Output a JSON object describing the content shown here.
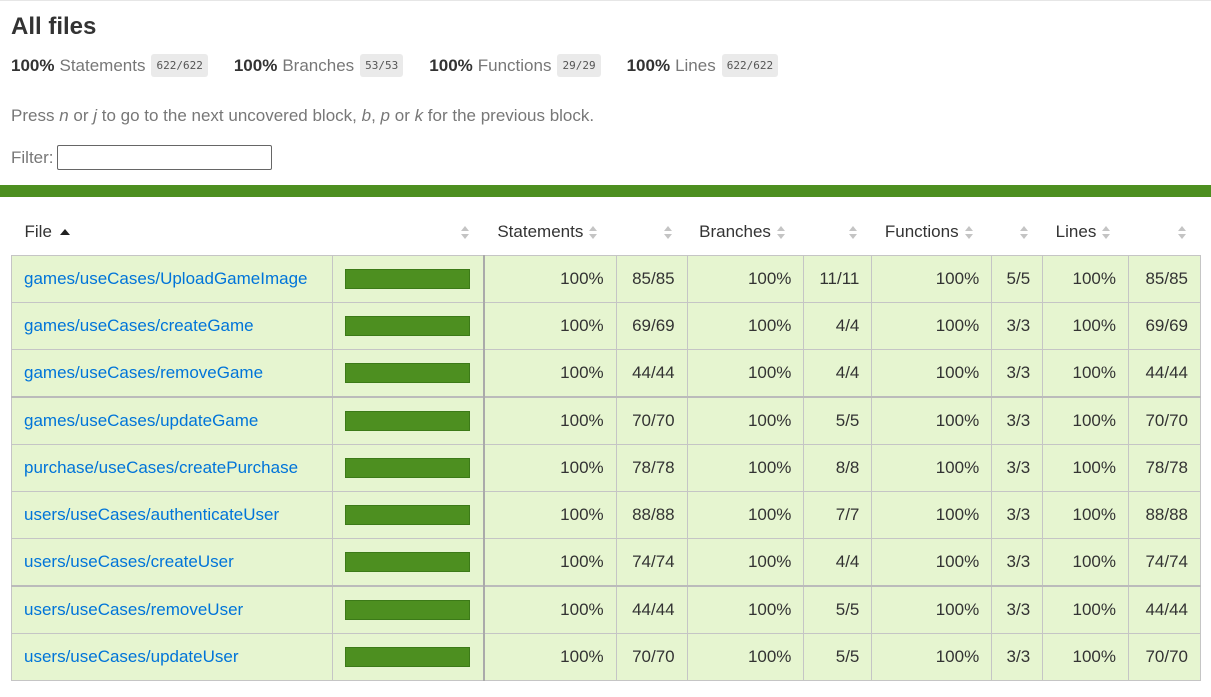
{
  "title": "All files",
  "summary": [
    {
      "pct": "100%",
      "label": "Statements",
      "frac": "622/622"
    },
    {
      "pct": "100%",
      "label": "Branches",
      "frac": "53/53"
    },
    {
      "pct": "100%",
      "label": "Functions",
      "frac": "29/29"
    },
    {
      "pct": "100%",
      "label": "Lines",
      "frac": "622/622"
    }
  ],
  "hint": {
    "t1": "Press ",
    "k1": "n",
    "t2": " or ",
    "k2": "j",
    "t3": " to go to the next uncovered block, ",
    "k3": "b",
    "t4": ", ",
    "k4": "p",
    "t5": " or ",
    "k5": "k",
    "t6": " for the previous block."
  },
  "filter": {
    "label": "Filter:",
    "value": ""
  },
  "headers": {
    "file": "File",
    "statements": "Statements",
    "branches": "Branches",
    "functions": "Functions",
    "lines": "Lines"
  },
  "colors": {
    "high_bg": "#e6f5d0",
    "bar": "#4d8f20",
    "link": "#0074d9"
  },
  "rows": [
    {
      "file": "games/useCases/UploadGameImage",
      "coverage": 1.0,
      "stmt_pct": "100%",
      "stmt": "85/85",
      "br_pct": "100%",
      "br": "11/11",
      "fn_pct": "100%",
      "fn": "5/5",
      "ln_pct": "100%",
      "ln": "85/85"
    },
    {
      "file": "games/useCases/createGame",
      "coverage": 1.0,
      "stmt_pct": "100%",
      "stmt": "69/69",
      "br_pct": "100%",
      "br": "4/4",
      "fn_pct": "100%",
      "fn": "3/3",
      "ln_pct": "100%",
      "ln": "69/69"
    },
    {
      "file": "games/useCases/removeGame",
      "coverage": 1.0,
      "stmt_pct": "100%",
      "stmt": "44/44",
      "br_pct": "100%",
      "br": "4/4",
      "fn_pct": "100%",
      "fn": "3/3",
      "ln_pct": "100%",
      "ln": "44/44"
    },
    {
      "file": "games/useCases/updateGame",
      "coverage": 1.0,
      "stmt_pct": "100%",
      "stmt": "70/70",
      "br_pct": "100%",
      "br": "5/5",
      "fn_pct": "100%",
      "fn": "3/3",
      "ln_pct": "100%",
      "ln": "70/70"
    },
    {
      "file": "purchase/useCases/createPurchase",
      "coverage": 1.0,
      "stmt_pct": "100%",
      "stmt": "78/78",
      "br_pct": "100%",
      "br": "8/8",
      "fn_pct": "100%",
      "fn": "3/3",
      "ln_pct": "100%",
      "ln": "78/78"
    },
    {
      "file": "users/useCases/authenticateUser",
      "coverage": 1.0,
      "stmt_pct": "100%",
      "stmt": "88/88",
      "br_pct": "100%",
      "br": "7/7",
      "fn_pct": "100%",
      "fn": "3/3",
      "ln_pct": "100%",
      "ln": "88/88"
    },
    {
      "file": "users/useCases/createUser",
      "coverage": 1.0,
      "stmt_pct": "100%",
      "stmt": "74/74",
      "br_pct": "100%",
      "br": "4/4",
      "fn_pct": "100%",
      "fn": "3/3",
      "ln_pct": "100%",
      "ln": "74/74"
    },
    {
      "file": "users/useCases/removeUser",
      "coverage": 1.0,
      "stmt_pct": "100%",
      "stmt": "44/44",
      "br_pct": "100%",
      "br": "5/5",
      "fn_pct": "100%",
      "fn": "3/3",
      "ln_pct": "100%",
      "ln": "44/44"
    },
    {
      "file": "users/useCases/updateUser",
      "coverage": 1.0,
      "stmt_pct": "100%",
      "stmt": "70/70",
      "br_pct": "100%",
      "br": "5/5",
      "fn_pct": "100%",
      "fn": "3/3",
      "ln_pct": "100%",
      "ln": "70/70"
    }
  ]
}
